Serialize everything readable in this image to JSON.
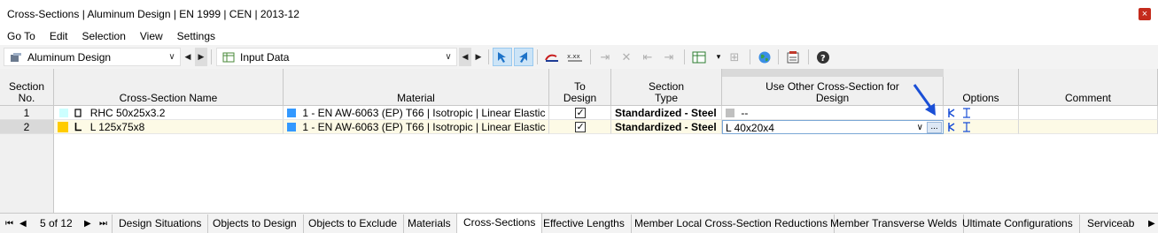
{
  "window": {
    "title": "Cross-Sections | Aluminum Design | EN 1999 | CEN | 2013-12",
    "close_glyph": "×"
  },
  "menu": [
    "Go To",
    "Edit",
    "Selection",
    "View",
    "Settings"
  ],
  "toolbar": {
    "module_combo": "Aluminum Design",
    "input_combo": "Input Data",
    "prev_glyph": "◀",
    "next_glyph": "▶",
    "chev": "∨"
  },
  "grid": {
    "headers": {
      "section_no": "Section No.",
      "name": "Cross-Section Name",
      "material": "Material",
      "to_design": "To Design",
      "section_type": "Section Type",
      "use_other": "Use Other Cross-Section for Design",
      "options": "Options",
      "comment": "Comment"
    },
    "rows": [
      {
        "no": "1",
        "name_color": "#ccffff",
        "name": "RHC 50x25x3.2",
        "material_color": "#3399ff",
        "material": "1 - EN AW-6063 (EP) T66 | Isotropic | Linear Elastic",
        "to_design": true,
        "section_type": "Standardized - Steel",
        "use_other_color": "#c0c0c0",
        "use_other": "--"
      },
      {
        "no": "2",
        "name_color": "#ffcc00",
        "name": "L 125x75x8",
        "material_color": "#3399ff",
        "material": "1 - EN AW-6063 (EP) T66 | Isotropic | Linear Elastic",
        "to_design": true,
        "section_type": "Standardized - Steel",
        "use_other": "L 40x20x4",
        "ellipsis": "..."
      }
    ]
  },
  "pager": {
    "first": "⏮",
    "prev": "◀",
    "text": "5 of 12",
    "next": "▶",
    "last": "⏭"
  },
  "tabs": [
    "Design Situations",
    "Objects to Design",
    "Objects to Exclude",
    "Materials",
    "Cross-Sections",
    "Effective Lengths",
    "Member Local Cross-Section Reductions",
    "Member Transverse Welds",
    "Ultimate Configurations",
    "Serviceab"
  ],
  "active_tab": "Cross-Sections",
  "colors": {
    "accent": "#1a4fd6",
    "selected_row": "#fdfae6",
    "header": "#f0f0f0"
  }
}
